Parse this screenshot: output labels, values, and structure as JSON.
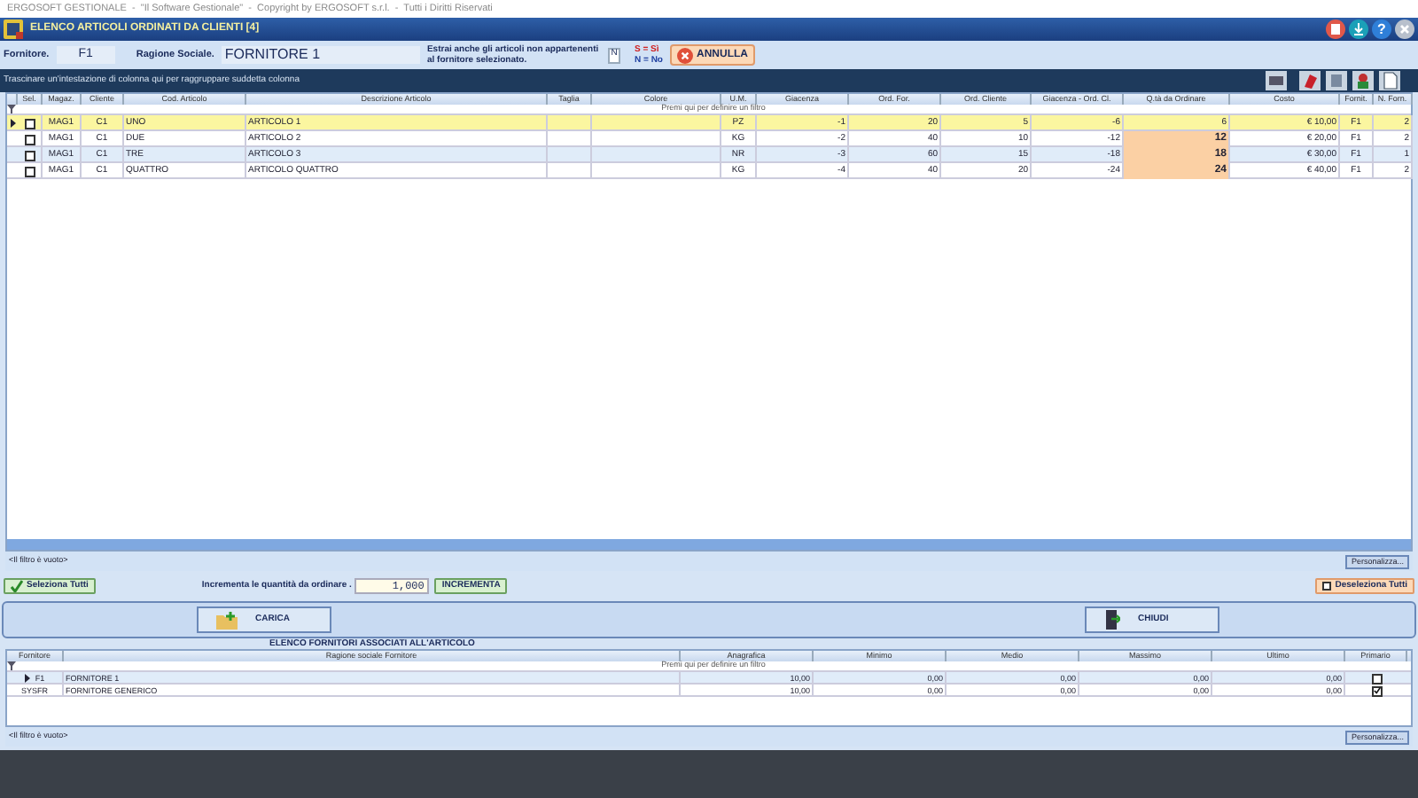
{
  "app_title": "ERGOSOFT GESTIONALE  -  \"Il Software Gestionale\"  -  Copyright by ERGOSOFT s.r.l.  -  Tutti i Diritti Riservati",
  "window": {
    "title": "ELENCO ARTICOLI ORDINATI DA CLIENTI [4]",
    "help_icon": "?"
  },
  "filter_bar": {
    "fornitore_label": "Fornitore.",
    "fornitore_value": "F1",
    "ragione_label": "Ragione Sociale.",
    "ragione_value": "FORNITORE 1",
    "extract_label": "Estrai anche gli articoli non appartenenti al fornitore selezionato.",
    "extract_value": "N",
    "legend_yes": "S = Sì",
    "legend_no": "N = No",
    "cancel_button": "ANNULLA"
  },
  "group_hint": "Trascinare un'intestazione di colonna qui per raggruppare suddetta colonna",
  "articles": {
    "columns": [
      "Sel.",
      "Magaz.",
      "Cliente",
      "Cod. Articolo",
      "Descrizione Articolo",
      "Taglia",
      "Colore",
      "U.M.",
      "Giacenza",
      "Ord. For.",
      "Ord. Cliente",
      "Giacenza - Ord. Cl.",
      "Q.tà da Ordinare",
      "Costo",
      "Fornit.",
      "N. Forn."
    ],
    "filter_prompt": "Premi qui per definire un filtro",
    "rows": [
      {
        "current": true,
        "checked": false,
        "qty_highlight": false,
        "cells": [
          "",
          "MAG1",
          "C1",
          "UNO",
          "ARTICOLO 1",
          "",
          "",
          "PZ",
          "-1",
          "20",
          "5",
          "-6",
          "6",
          "€ 10,00",
          "F1",
          "2"
        ]
      },
      {
        "current": false,
        "checked": false,
        "qty_highlight": true,
        "cells": [
          "",
          "MAG1",
          "C1",
          "DUE",
          "ARTICOLO 2",
          "",
          "",
          "KG",
          "-2",
          "40",
          "10",
          "-12",
          "12",
          "€ 20,00",
          "F1",
          "2"
        ]
      },
      {
        "current": false,
        "checked": false,
        "qty_highlight": true,
        "cells": [
          "",
          "MAG1",
          "C1",
          "TRE",
          "ARTICOLO 3",
          "",
          "",
          "NR",
          "-3",
          "60",
          "15",
          "-18",
          "18",
          "€ 30,00",
          "F1",
          "1"
        ]
      },
      {
        "current": false,
        "checked": false,
        "qty_highlight": true,
        "cells": [
          "",
          "MAG1",
          "C1",
          "QUATTRO",
          "ARTICOLO QUATTRO",
          "",
          "",
          "KG",
          "-4",
          "40",
          "20",
          "-24",
          "24",
          "€ 40,00",
          "F1",
          "2"
        ]
      }
    ],
    "filter_status": "<Il filtro è vuoto>",
    "customize_button": "Personalizza..."
  },
  "actions": {
    "select_all": "Seleziona Tutti",
    "increment_label": "Incrementa le quantità da ordinare .",
    "increment_value": "1,000",
    "increment_button": "INCREMENTA",
    "deselect_all": "Deseleziona Tutti",
    "load_button": "CARICA",
    "close_button": "CHIUDI"
  },
  "suppliers": {
    "title": "ELENCO FORNITORI ASSOCIATI ALL'ARTICOLO",
    "columns": [
      "Fornitore",
      "Ragione sociale Fornitore",
      "Anagrafica",
      "Minimo",
      "Medio",
      "Massimo",
      "Ultimo",
      "Primario"
    ],
    "filter_prompt": "Premi qui per definire un filtro",
    "rows": [
      {
        "current": true,
        "primary": false,
        "cells": [
          "F1",
          "FORNITORE 1",
          "10,00",
          "0,00",
          "0,00",
          "0,00",
          "0,00"
        ]
      },
      {
        "current": false,
        "primary": true,
        "cells": [
          "SYSFR",
          "FORNITORE GENERICO",
          "10,00",
          "0,00",
          "0,00",
          "0,00",
          "0,00"
        ]
      }
    ],
    "filter_status": "<Il filtro è vuoto>",
    "customize_button": "Personalizza..."
  }
}
